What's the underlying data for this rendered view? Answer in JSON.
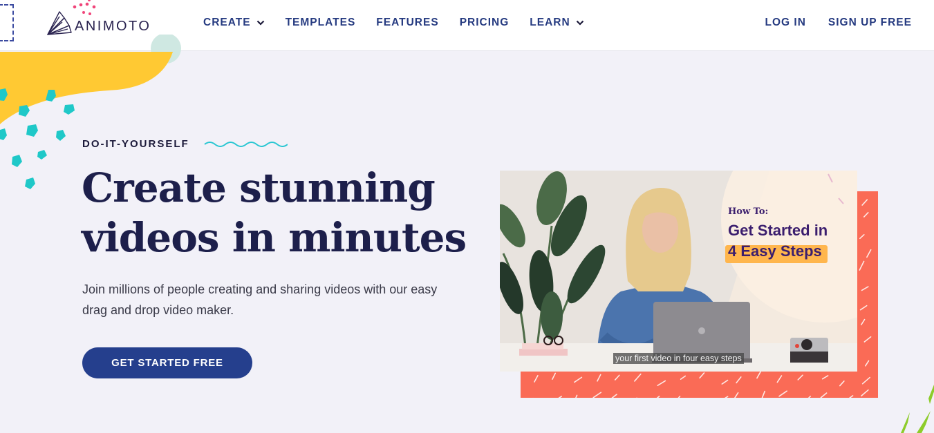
{
  "header": {
    "logo_text": "ANIMOTO",
    "nav": [
      {
        "label": "CREATE",
        "has_dropdown": true
      },
      {
        "label": "TEMPLATES",
        "has_dropdown": false
      },
      {
        "label": "FEATURES",
        "has_dropdown": false
      },
      {
        "label": "PRICING",
        "has_dropdown": false
      },
      {
        "label": "LEARN",
        "has_dropdown": true
      }
    ],
    "login_label": "LOG IN",
    "signup_label": "SIGN UP FREE"
  },
  "hero": {
    "eyebrow": "DO-IT-YOURSELF",
    "headline_line1": "Create stunning",
    "headline_line2": "videos in minutes",
    "subtext": "Join millions of people creating and sharing videos with our easy drag and drop video maker.",
    "cta_label": "GET STARTED FREE"
  },
  "video": {
    "overlay_kicker": "How To:",
    "overlay_title_line1": "Get Started in",
    "overlay_title_line2": "4 Easy Steps",
    "caption": "your first video in four easy steps"
  },
  "colors": {
    "brand_navy": "#253f8d",
    "headline": "#1d1f4b",
    "accent_yellow": "#ffc933",
    "accent_teal": "#1fc8c8",
    "accent_coral": "#fa6b56",
    "accent_pink": "#f0457a",
    "overlay_purple": "#3b1e6e",
    "overlay_orange": "#ffb64d"
  }
}
